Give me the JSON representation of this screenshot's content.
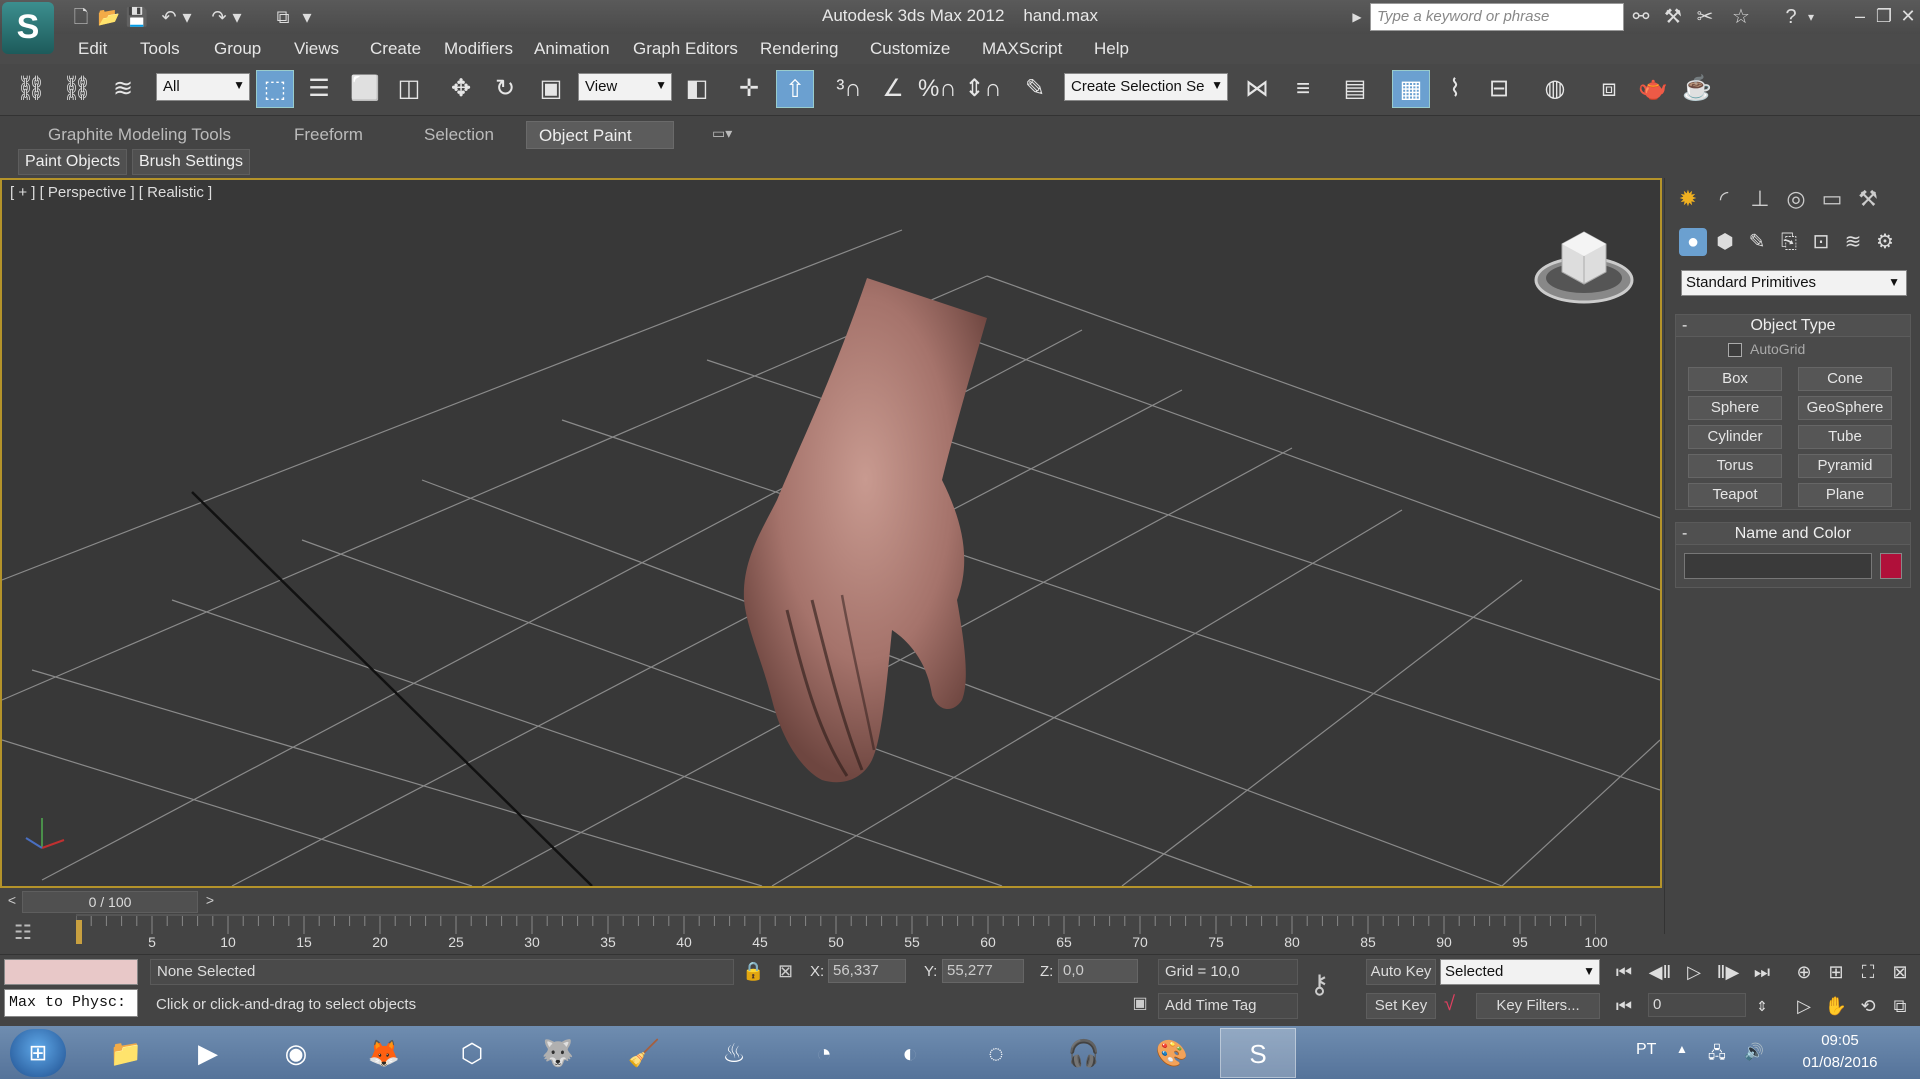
{
  "titlebar": {
    "logo": "S",
    "app_name": "Autodesk 3ds Max 2012",
    "file_name": "hand.max",
    "search_placeholder": "Type a keyword or phrase"
  },
  "menu": [
    "Edit",
    "Tools",
    "Group",
    "Views",
    "Create",
    "Modifiers",
    "Animation",
    "Graph Editors",
    "Rendering",
    "Customize",
    "MAXScript",
    "Help"
  ],
  "toolbar": {
    "selection_filter": "All",
    "reference_coord": "View",
    "named_selection_placeholder": "Create Selection Se"
  },
  "ribbon": {
    "tabs": [
      "Graphite Modeling Tools",
      "Freeform",
      "Selection",
      "Object Paint"
    ],
    "active_tab": "Object Paint",
    "sub_buttons": [
      "Paint Objects",
      "Brush Settings"
    ]
  },
  "viewport": {
    "label": "[ + ] [ Perspective ] [ Realistic ]"
  },
  "command_panel": {
    "category": "Standard Primitives",
    "object_type_title": "Object Type",
    "autogrid_label": "AutoGrid",
    "primitives": [
      "Box",
      "Cone",
      "Sphere",
      "GeoSphere",
      "Cylinder",
      "Tube",
      "Torus",
      "Pyramid",
      "Teapot",
      "Plane"
    ],
    "name_color_title": "Name and Color",
    "object_name": "",
    "object_color": "#b0103a"
  },
  "timeline": {
    "frame_display": "0 / 100",
    "ticks": [
      "5",
      "10",
      "15",
      "20",
      "25",
      "30",
      "35",
      "40",
      "45",
      "50",
      "55",
      "60",
      "65",
      "70",
      "75",
      "80",
      "85",
      "90",
      "95",
      "100"
    ]
  },
  "status": {
    "listener_label": "Max to Physc:",
    "selection": "None Selected",
    "prompt": "Click or click-and-drag to select objects",
    "x_label": "X:",
    "x_value": "56,337",
    "y_label": "Y:",
    "y_value": "55,277",
    "z_label": "Z:",
    "z_value": "0,0",
    "grid": "Grid = 10,0",
    "add_time_tag": "Add Time Tag",
    "auto_key": "Auto Key",
    "set_key": "Set Key",
    "key_mode": "Selected",
    "key_filters": "Key Filters...",
    "current_frame": "0"
  },
  "taskbar": {
    "language": "PT",
    "time": "09:05",
    "date": "01/08/2016"
  },
  "colors": {
    "viewport_border": "#b4932a",
    "active_button": "#6ba0d0"
  }
}
